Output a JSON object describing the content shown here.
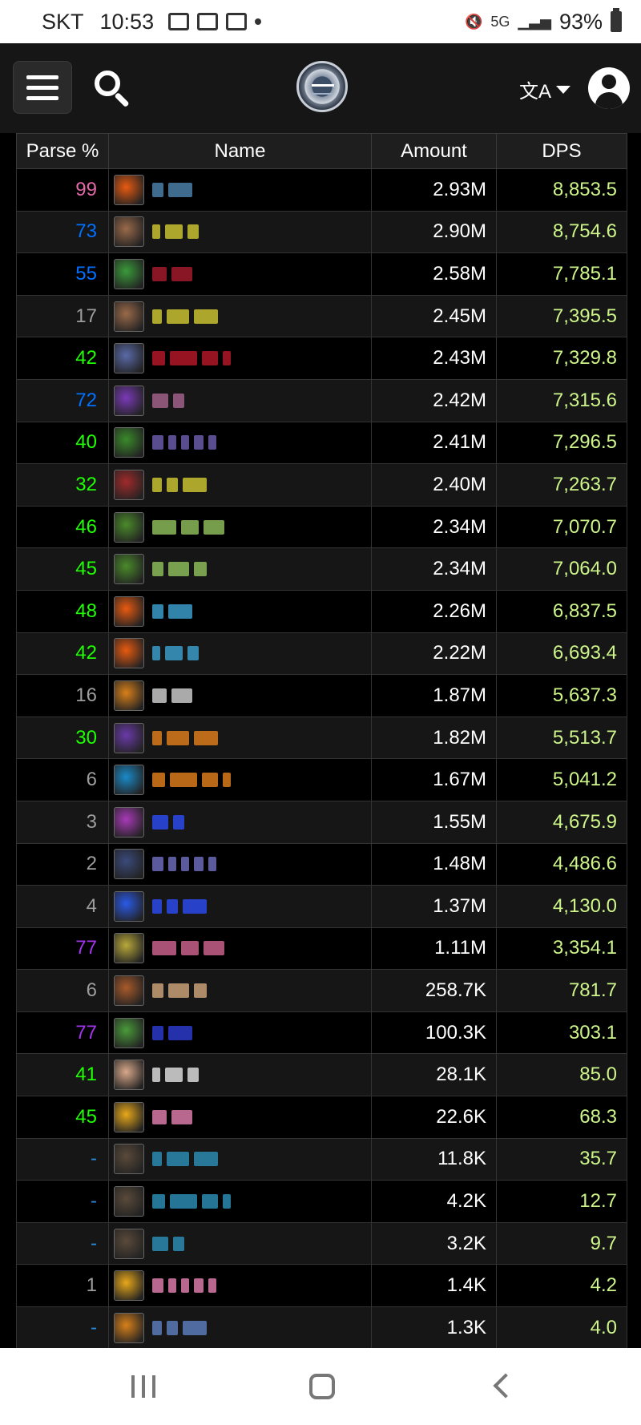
{
  "status_bar": {
    "carrier": "SKT",
    "time": "10:53",
    "network": "5G",
    "battery": "93%"
  },
  "table": {
    "headers": {
      "parse": "Parse %",
      "name": "Name",
      "amount": "Amount",
      "dps": "DPS"
    },
    "rows": [
      {
        "parse": "99",
        "parse_color": "#e268a8",
        "icon_color": "#e85a10",
        "name_color": "#4a7ea8",
        "amount": "2.93M",
        "dps": "8,853.5"
      },
      {
        "parse": "73",
        "parse_color": "#0070ff",
        "icon_color": "#9a6a4a",
        "name_color": "#c8c030",
        "amount": "2.90M",
        "dps": "8,754.6"
      },
      {
        "parse": "55",
        "parse_color": "#0070ff",
        "icon_color": "#3a9a3a",
        "name_color": "#a01a2a",
        "amount": "2.58M",
        "dps": "7,785.1"
      },
      {
        "parse": "17",
        "parse_color": "#9d9d9d",
        "icon_color": "#9a6a4a",
        "name_color": "#c8c030",
        "amount": "2.45M",
        "dps": "7,395.5"
      },
      {
        "parse": "42",
        "parse_color": "#1eff00",
        "icon_color": "#5a6aa8",
        "name_color": "#b01828",
        "amount": "2.43M",
        "dps": "7,329.8"
      },
      {
        "parse": "72",
        "parse_color": "#0070ff",
        "icon_color": "#7a3ab8",
        "name_color": "#a0608a",
        "amount": "2.42M",
        "dps": "7,315.6"
      },
      {
        "parse": "40",
        "parse_color": "#1eff00",
        "icon_color": "#3a8a2a",
        "name_color": "#6a5aa8",
        "amount": "2.41M",
        "dps": "7,296.5"
      },
      {
        "parse": "32",
        "parse_color": "#1eff00",
        "icon_color": "#a02a2a",
        "name_color": "#c8c030",
        "amount": "2.40M",
        "dps": "7,263.7"
      },
      {
        "parse": "46",
        "parse_color": "#1eff00",
        "icon_color": "#4a8a2a",
        "name_color": "#8ab858",
        "amount": "2.34M",
        "dps": "7,070.7"
      },
      {
        "parse": "45",
        "parse_color": "#1eff00",
        "icon_color": "#4a8a2a",
        "name_color": "#8ab858",
        "amount": "2.34M",
        "dps": "7,064.0"
      },
      {
        "parse": "48",
        "parse_color": "#1eff00",
        "icon_color": "#e85a10",
        "name_color": "#3a9ac8",
        "amount": "2.26M",
        "dps": "6,837.5"
      },
      {
        "parse": "42",
        "parse_color": "#1eff00",
        "icon_color": "#e85a10",
        "name_color": "#3a9ac8",
        "amount": "2.22M",
        "dps": "6,693.4"
      },
      {
        "parse": "16",
        "parse_color": "#9d9d9d",
        "icon_color": "#d8801a",
        "name_color": "#c8c8c8",
        "amount": "1.87M",
        "dps": "5,637.3"
      },
      {
        "parse": "30",
        "parse_color": "#1eff00",
        "icon_color": "#6a3aa8",
        "name_color": "#d87a1a",
        "amount": "1.82M",
        "dps": "5,513.7"
      },
      {
        "parse": "6",
        "parse_color": "#9d9d9d",
        "icon_color": "#1a8ac8",
        "name_color": "#d87a1a",
        "amount": "1.67M",
        "dps": "5,041.2"
      },
      {
        "parse": "3",
        "parse_color": "#9d9d9d",
        "icon_color": "#a83ab8",
        "name_color": "#2a4ae8",
        "amount": "1.55M",
        "dps": "4,675.9"
      },
      {
        "parse": "2",
        "parse_color": "#9d9d9d",
        "icon_color": "#3a4a7a",
        "name_color": "#6a6ab8",
        "amount": "1.48M",
        "dps": "4,486.6"
      },
      {
        "parse": "4",
        "parse_color": "#9d9d9d",
        "icon_color": "#2a5ae8",
        "name_color": "#2a4ae8",
        "amount": "1.37M",
        "dps": "4,130.0"
      },
      {
        "parse": "77",
        "parse_color": "#a335ee",
        "icon_color": "#b8a83a",
        "name_color": "#c8608a",
        "amount": "1.11M",
        "dps": "3,354.1"
      },
      {
        "parse": "6",
        "parse_color": "#9d9d9d",
        "icon_color": "#a85a2a",
        "name_color": "#c8a078",
        "amount": "258.7K",
        "dps": "781.7"
      },
      {
        "parse": "77",
        "parse_color": "#a335ee",
        "icon_color": "#4a9a3a",
        "name_color": "#2a3ac8",
        "amount": "100.3K",
        "dps": "303.1"
      },
      {
        "parse": "41",
        "parse_color": "#1eff00",
        "icon_color": "#d8a88a",
        "name_color": "#d8d8d8",
        "amount": "28.1K",
        "dps": "85.0"
      },
      {
        "parse": "45",
        "parse_color": "#1eff00",
        "icon_color": "#e8a81a",
        "name_color": "#d87aa8",
        "amount": "22.6K",
        "dps": "68.3"
      },
      {
        "parse": "-",
        "parse_color": "#2a8ad8",
        "icon_color": "#5a4a3a",
        "name_color": "#2a8ab0",
        "amount": "11.8K",
        "dps": "35.7"
      },
      {
        "parse": "-",
        "parse_color": "#2a8ad8",
        "icon_color": "#5a4a3a",
        "name_color": "#2a8ab0",
        "amount": "4.2K",
        "dps": "12.7"
      },
      {
        "parse": "-",
        "parse_color": "#2a8ad8",
        "icon_color": "#5a4a3a",
        "name_color": "#2a8ab0",
        "amount": "3.2K",
        "dps": "9.7"
      },
      {
        "parse": "1",
        "parse_color": "#9d9d9d",
        "icon_color": "#e8a81a",
        "name_color": "#d87aa8",
        "amount": "1.4K",
        "dps": "4.2"
      },
      {
        "parse": "-",
        "parse_color": "#2a8ad8",
        "icon_color": "#d8801a",
        "name_color": "#5a7ab8",
        "amount": "1.3K",
        "dps": "4.0"
      }
    ]
  }
}
